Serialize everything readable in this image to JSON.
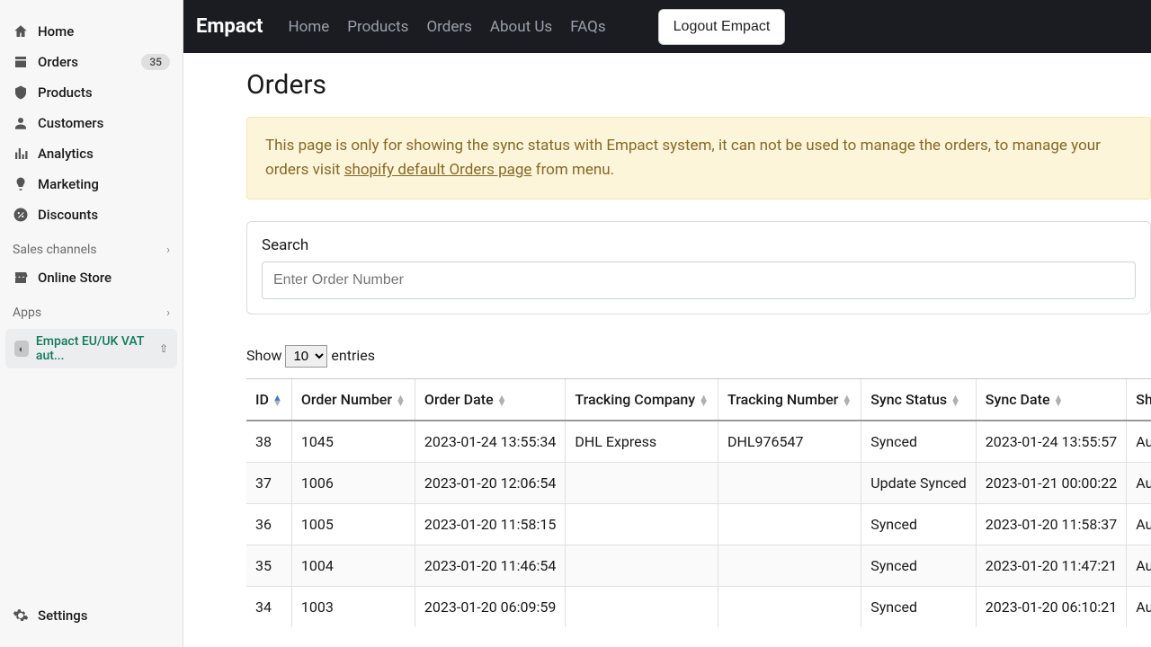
{
  "sidebar": {
    "items": [
      {
        "label": "Home",
        "icon": "home"
      },
      {
        "label": "Orders",
        "icon": "orders",
        "badge": "35"
      },
      {
        "label": "Products",
        "icon": "products"
      },
      {
        "label": "Customers",
        "icon": "customers"
      },
      {
        "label": "Analytics",
        "icon": "analytics"
      },
      {
        "label": "Marketing",
        "icon": "marketing"
      },
      {
        "label": "Discounts",
        "icon": "discounts"
      }
    ],
    "channels_heading": "Sales channels",
    "channels": [
      {
        "label": "Online Store",
        "icon": "store"
      }
    ],
    "apps_heading": "Apps",
    "apps": [
      {
        "label": "Empact EU/UK VAT aut..."
      }
    ],
    "settings_label": "Settings"
  },
  "topnav": {
    "brand": "Empact",
    "links": [
      "Home",
      "Products",
      "Orders",
      "About Us",
      "FAQs"
    ],
    "logout": "Logout Empact"
  },
  "page": {
    "title": "Orders",
    "alert_pre": "This page is only for showing the sync status with Empact system, it can not be used to manage the orders, to manage your orders visit ",
    "alert_link": "shopify default Orders page",
    "alert_post": " from menu.",
    "search_label": "Search",
    "search_placeholder": "Enter Order Number",
    "show_label_pre": "Show",
    "show_label_post": "entries",
    "show_value": "10"
  },
  "table": {
    "columns": [
      "ID",
      "Order Number",
      "Order Date",
      "Tracking Company",
      "Tracking Number",
      "Sync Status",
      "Sync Date",
      "Shipping Count"
    ],
    "sort_col": 0,
    "sort_dir": "asc",
    "rows": [
      {
        "id": "38",
        "order_number": "1045",
        "order_date": "2023-01-24 13:55:34",
        "tracking_company": "DHL Express",
        "tracking_number": "DHL976547",
        "sync_status": "Synced",
        "sync_date": "2023-01-24 13:55:57",
        "shipping_country": "Austria"
      },
      {
        "id": "37",
        "order_number": "1006",
        "order_date": "2023-01-20 12:06:54",
        "tracking_company": "",
        "tracking_number": "",
        "sync_status": "Update Synced",
        "sync_date": "2023-01-21 00:00:22",
        "shipping_country": "Austria"
      },
      {
        "id": "36",
        "order_number": "1005",
        "order_date": "2023-01-20 11:58:15",
        "tracking_company": "",
        "tracking_number": "",
        "sync_status": "Synced",
        "sync_date": "2023-01-20 11:58:37",
        "shipping_country": "Austria"
      },
      {
        "id": "35",
        "order_number": "1004",
        "order_date": "2023-01-20 11:46:54",
        "tracking_company": "",
        "tracking_number": "",
        "sync_status": "Synced",
        "sync_date": "2023-01-20 11:47:21",
        "shipping_country": "Austria"
      },
      {
        "id": "34",
        "order_number": "1003",
        "order_date": "2023-01-20 06:09:59",
        "tracking_company": "",
        "tracking_number": "",
        "sync_status": "Synced",
        "sync_date": "2023-01-20 06:10:21",
        "shipping_country": "Austria"
      }
    ]
  }
}
